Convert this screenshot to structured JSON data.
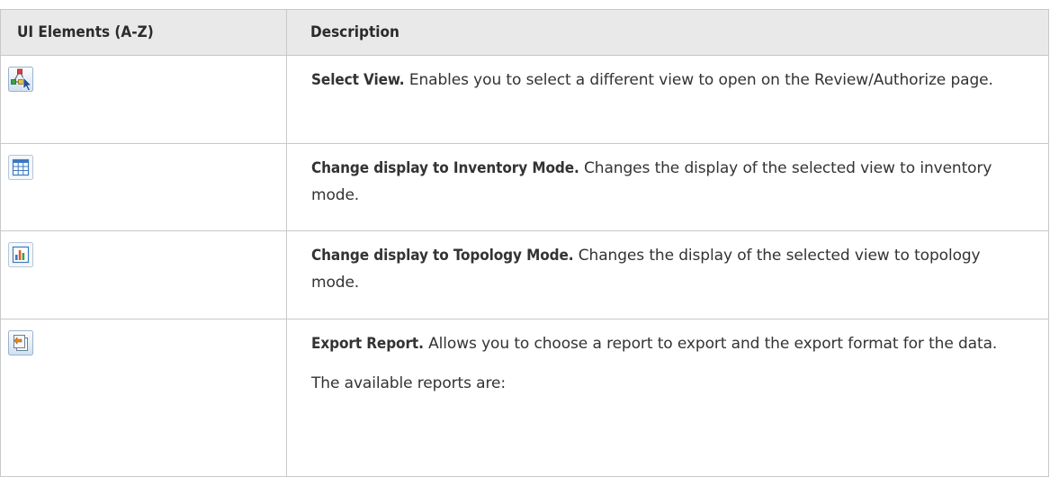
{
  "table": {
    "header": {
      "col1": "UI Elements (A-Z)",
      "col2": "Description"
    },
    "rows": [
      {
        "icon": "select-view-icon",
        "term": "Select View.",
        "text": " Enables you to select a different view to open on the Review/Authorize page."
      },
      {
        "icon": "inventory-mode-icon",
        "term": "Change display to Inventory Mode.",
        "text": " Changes the display of the selected view to inventory mode."
      },
      {
        "icon": "topology-mode-icon",
        "term": "Change display to Topology Mode.",
        "text": " Changes the display of the selected view to topology mode."
      },
      {
        "icon": "export-report-icon",
        "term": "Export Report.",
        "text": " Allows you to choose a report to export and the export format for the data.",
        "extra": "The available reports are:"
      }
    ]
  },
  "colors": {
    "header_bg": "#e9e9e9",
    "border": "#c8c8c8",
    "text": "#333333",
    "icon_blue": "#3d7ac0"
  }
}
